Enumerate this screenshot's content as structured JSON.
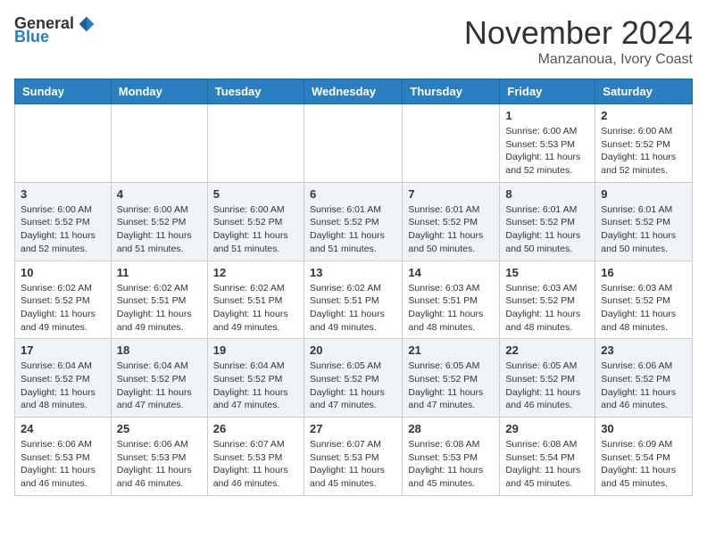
{
  "header": {
    "logo_general": "General",
    "logo_blue": "Blue",
    "month_title": "November 2024",
    "location": "Manzanoua, Ivory Coast"
  },
  "days_of_week": [
    "Sunday",
    "Monday",
    "Tuesday",
    "Wednesday",
    "Thursday",
    "Friday",
    "Saturday"
  ],
  "weeks": [
    [
      {
        "day": "",
        "info": ""
      },
      {
        "day": "",
        "info": ""
      },
      {
        "day": "",
        "info": ""
      },
      {
        "day": "",
        "info": ""
      },
      {
        "day": "",
        "info": ""
      },
      {
        "day": "1",
        "info": "Sunrise: 6:00 AM\nSunset: 5:53 PM\nDaylight: 11 hours\nand 52 minutes."
      },
      {
        "day": "2",
        "info": "Sunrise: 6:00 AM\nSunset: 5:52 PM\nDaylight: 11 hours\nand 52 minutes."
      }
    ],
    [
      {
        "day": "3",
        "info": "Sunrise: 6:00 AM\nSunset: 5:52 PM\nDaylight: 11 hours\nand 52 minutes."
      },
      {
        "day": "4",
        "info": "Sunrise: 6:00 AM\nSunset: 5:52 PM\nDaylight: 11 hours\nand 51 minutes."
      },
      {
        "day": "5",
        "info": "Sunrise: 6:00 AM\nSunset: 5:52 PM\nDaylight: 11 hours\nand 51 minutes."
      },
      {
        "day": "6",
        "info": "Sunrise: 6:01 AM\nSunset: 5:52 PM\nDaylight: 11 hours\nand 51 minutes."
      },
      {
        "day": "7",
        "info": "Sunrise: 6:01 AM\nSunset: 5:52 PM\nDaylight: 11 hours\nand 50 minutes."
      },
      {
        "day": "8",
        "info": "Sunrise: 6:01 AM\nSunset: 5:52 PM\nDaylight: 11 hours\nand 50 minutes."
      },
      {
        "day": "9",
        "info": "Sunrise: 6:01 AM\nSunset: 5:52 PM\nDaylight: 11 hours\nand 50 minutes."
      }
    ],
    [
      {
        "day": "10",
        "info": "Sunrise: 6:02 AM\nSunset: 5:52 PM\nDaylight: 11 hours\nand 49 minutes."
      },
      {
        "day": "11",
        "info": "Sunrise: 6:02 AM\nSunset: 5:51 PM\nDaylight: 11 hours\nand 49 minutes."
      },
      {
        "day": "12",
        "info": "Sunrise: 6:02 AM\nSunset: 5:51 PM\nDaylight: 11 hours\nand 49 minutes."
      },
      {
        "day": "13",
        "info": "Sunrise: 6:02 AM\nSunset: 5:51 PM\nDaylight: 11 hours\nand 49 minutes."
      },
      {
        "day": "14",
        "info": "Sunrise: 6:03 AM\nSunset: 5:51 PM\nDaylight: 11 hours\nand 48 minutes."
      },
      {
        "day": "15",
        "info": "Sunrise: 6:03 AM\nSunset: 5:52 PM\nDaylight: 11 hours\nand 48 minutes."
      },
      {
        "day": "16",
        "info": "Sunrise: 6:03 AM\nSunset: 5:52 PM\nDaylight: 11 hours\nand 48 minutes."
      }
    ],
    [
      {
        "day": "17",
        "info": "Sunrise: 6:04 AM\nSunset: 5:52 PM\nDaylight: 11 hours\nand 48 minutes."
      },
      {
        "day": "18",
        "info": "Sunrise: 6:04 AM\nSunset: 5:52 PM\nDaylight: 11 hours\nand 47 minutes."
      },
      {
        "day": "19",
        "info": "Sunrise: 6:04 AM\nSunset: 5:52 PM\nDaylight: 11 hours\nand 47 minutes."
      },
      {
        "day": "20",
        "info": "Sunrise: 6:05 AM\nSunset: 5:52 PM\nDaylight: 11 hours\nand 47 minutes."
      },
      {
        "day": "21",
        "info": "Sunrise: 6:05 AM\nSunset: 5:52 PM\nDaylight: 11 hours\nand 47 minutes."
      },
      {
        "day": "22",
        "info": "Sunrise: 6:05 AM\nSunset: 5:52 PM\nDaylight: 11 hours\nand 46 minutes."
      },
      {
        "day": "23",
        "info": "Sunrise: 6:06 AM\nSunset: 5:52 PM\nDaylight: 11 hours\nand 46 minutes."
      }
    ],
    [
      {
        "day": "24",
        "info": "Sunrise: 6:06 AM\nSunset: 5:53 PM\nDaylight: 11 hours\nand 46 minutes."
      },
      {
        "day": "25",
        "info": "Sunrise: 6:06 AM\nSunset: 5:53 PM\nDaylight: 11 hours\nand 46 minutes."
      },
      {
        "day": "26",
        "info": "Sunrise: 6:07 AM\nSunset: 5:53 PM\nDaylight: 11 hours\nand 46 minutes."
      },
      {
        "day": "27",
        "info": "Sunrise: 6:07 AM\nSunset: 5:53 PM\nDaylight: 11 hours\nand 45 minutes."
      },
      {
        "day": "28",
        "info": "Sunrise: 6:08 AM\nSunset: 5:53 PM\nDaylight: 11 hours\nand 45 minutes."
      },
      {
        "day": "29",
        "info": "Sunrise: 6:08 AM\nSunset: 5:54 PM\nDaylight: 11 hours\nand 45 minutes."
      },
      {
        "day": "30",
        "info": "Sunrise: 6:09 AM\nSunset: 5:54 PM\nDaylight: 11 hours\nand 45 minutes."
      }
    ]
  ]
}
